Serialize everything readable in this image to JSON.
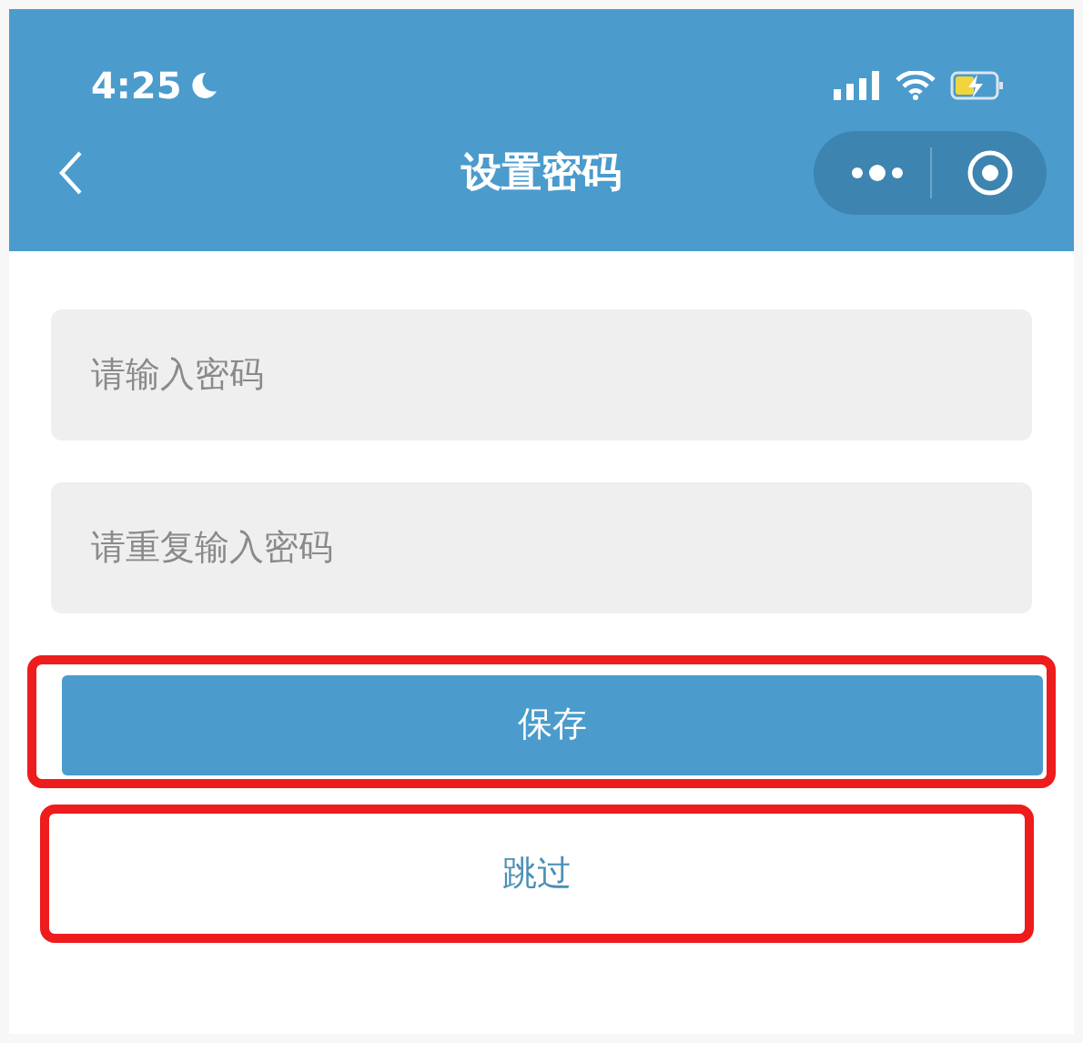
{
  "status_bar": {
    "time": "4:25"
  },
  "nav": {
    "title": "设置密码"
  },
  "fields": [
    {
      "placeholder": "请输入密码"
    },
    {
      "placeholder": "请重复输入密码"
    }
  ],
  "buttons": [
    {
      "label": "保存",
      "kind": "primary",
      "highlighted": true
    },
    {
      "label": "跳过",
      "kind": "plain",
      "highlighted": true
    }
  ]
}
